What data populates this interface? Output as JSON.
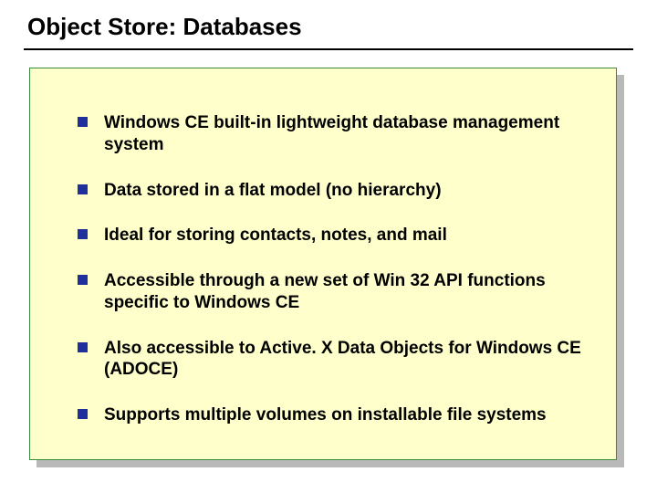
{
  "title": "Object Store: Databases",
  "bullets": [
    {
      "text": "Windows CE built-in lightweight database management system"
    },
    {
      "text": "Data stored in a flat model (no hierarchy)"
    },
    {
      "text": "Ideal for storing contacts, notes, and mail"
    },
    {
      "text": "Accessible through a new set of Win 32 API functions specific to Windows CE"
    },
    {
      "text": "Also accessible to Active. X Data Objects for Windows CE (ADOCE)"
    },
    {
      "text": "Supports multiple volumes on installable file systems"
    }
  ],
  "colors": {
    "panel_bg": "#ffffcc",
    "panel_border": "#3b8a3b",
    "bullet_marker": "#1f2f9b",
    "shadow": "#b9b9b9"
  }
}
